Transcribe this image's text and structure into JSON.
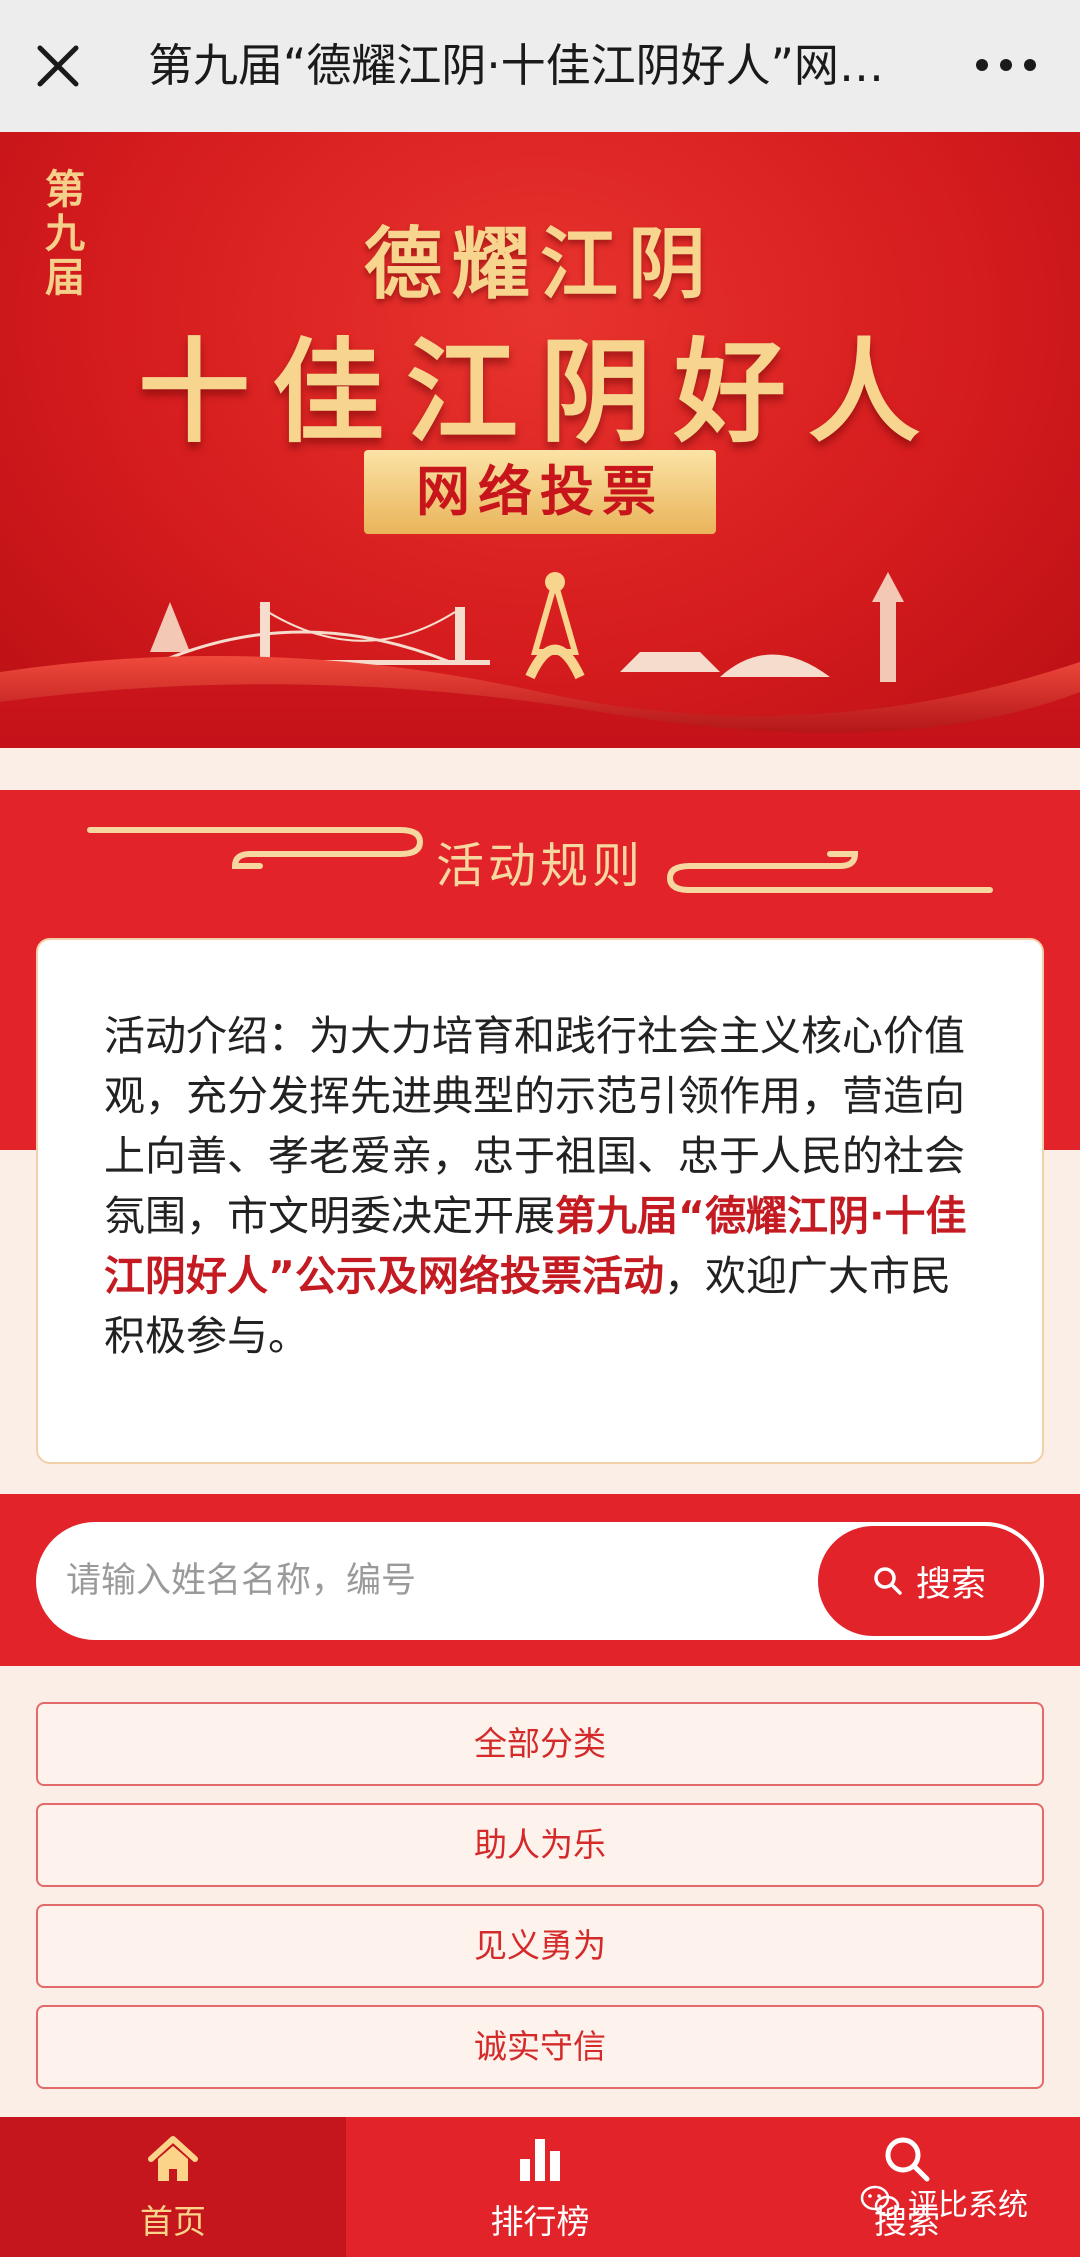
{
  "titlebar": {
    "title": "第九届“德耀江阴·十佳江阴好人”网络…"
  },
  "banner": {
    "edition": "第九届",
    "line1": "德耀江阴",
    "line2": "十佳江阴好人",
    "badge": "网络投票"
  },
  "rules": {
    "title": "活动规则",
    "text_before": "活动介绍：为大力培育和践行社会主义核心价值观，充分发挥先进典型的示范引领作用，营造向上向善、孝老爱亲，忠于祖国、忠于人民的社会氛围，市文明委决定开展",
    "highlight": "第九届“德耀江阴·十佳江阴好人”公示及网络投票活动",
    "text_after": "，欢迎广大市民积极参与。"
  },
  "search": {
    "placeholder": "请输入姓名名称，编号",
    "value": "",
    "button_label": "搜索"
  },
  "categories": [
    "全部分类",
    "助人为乐",
    "见义勇为",
    "诚实守信"
  ],
  "tabs": [
    {
      "label": "首页",
      "icon": "home-icon",
      "active": true
    },
    {
      "label": "排行榜",
      "icon": "bar-chart-icon",
      "active": false
    },
    {
      "label": "搜索",
      "icon": "search-icon",
      "active": false
    }
  ],
  "watermark": {
    "label": "评比系统",
    "icon": "wechat-icon"
  },
  "colors": {
    "brand_red": "#e2232a",
    "gold": "#f7d58e",
    "highlight_red": "#c41a22"
  }
}
